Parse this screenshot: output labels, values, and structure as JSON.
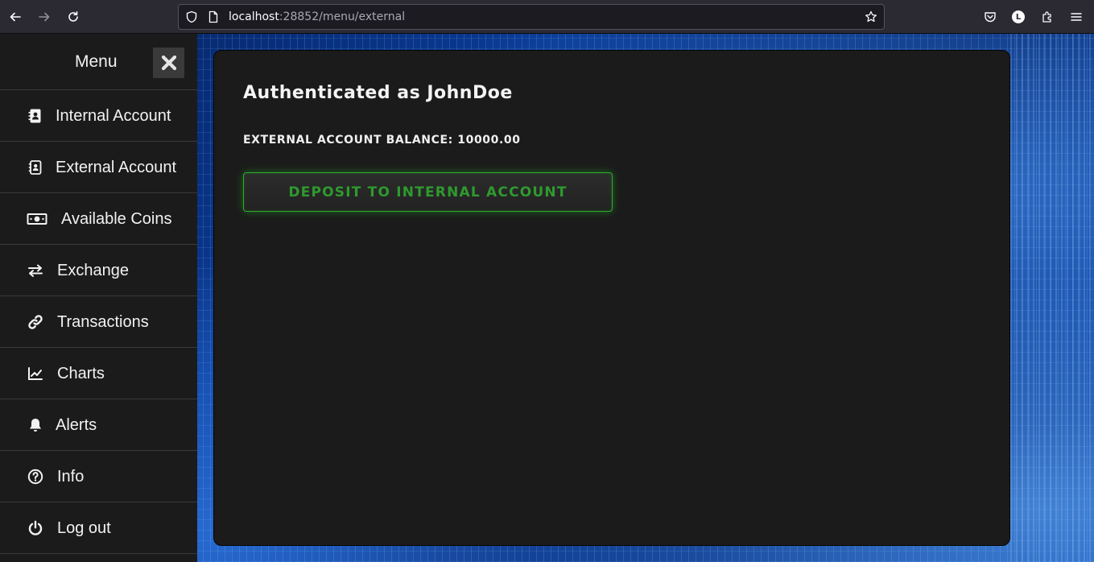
{
  "browser": {
    "url_host": "localhost",
    "url_port_path": ":28852/menu/external",
    "account_initial": "L",
    "icons": [
      "back-icon",
      "forward-icon",
      "reload-icon",
      "tracking-shield-icon",
      "page-icon",
      "bookmark-star-icon",
      "pocket-icon",
      "account-icon",
      "extensions-icon",
      "hamburger-menu-icon"
    ]
  },
  "sidebar": {
    "title": "Menu",
    "close_icon": "close-icon",
    "items": [
      {
        "label": "Internal Account",
        "icon": "contact-book-icon"
      },
      {
        "label": "External Account",
        "icon": "contact-card-outline-icon"
      },
      {
        "label": "Available Coins",
        "icon": "money-bill-icon"
      },
      {
        "label": "Exchange",
        "icon": "exchange-arrows-icon"
      },
      {
        "label": "Transactions",
        "icon": "link-icon"
      },
      {
        "label": "Charts",
        "icon": "line-chart-icon"
      },
      {
        "label": "Alerts",
        "icon": "bell-icon"
      },
      {
        "label": "Info",
        "icon": "question-circle-icon"
      },
      {
        "label": "Log out",
        "icon": "power-icon"
      }
    ]
  },
  "main": {
    "title": "Authenticated as JohnDoe",
    "balance_label": "EXTERNAL ACCOUNT BALANCE: 10000.00",
    "deposit_button": "DEPOSIT TO INTERNAL ACCOUNT"
  },
  "colors": {
    "sidebar_bg": "#1b1b1b",
    "card_bg": "#1b1b1b",
    "button_accent": "#2e9a2e",
    "background_blue": "#0a3b96"
  }
}
